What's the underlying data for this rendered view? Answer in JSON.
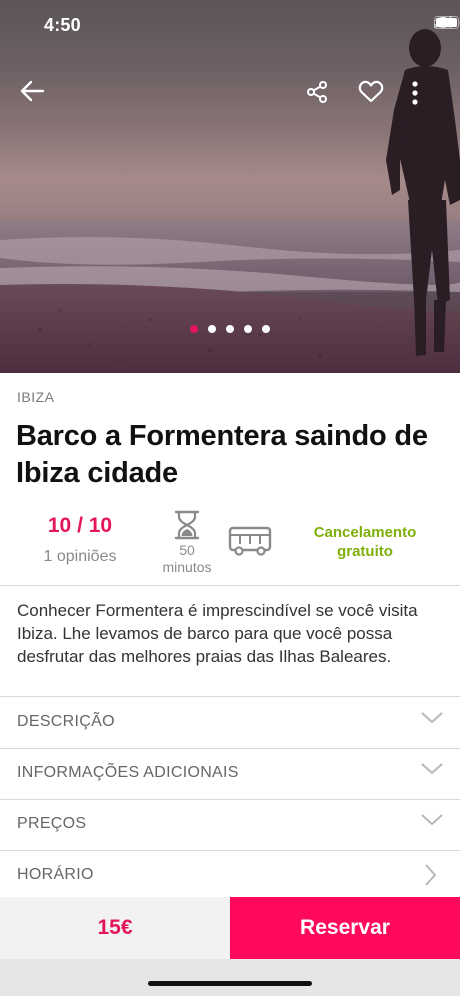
{
  "status_bar": {
    "time": "4:50"
  },
  "hero": {
    "carousel_total": 5,
    "carousel_active": 1
  },
  "activity": {
    "city": "IBIZA",
    "title": "Barco a Formentera saindo de Ibiza cidade",
    "rating_score": "10 / 10",
    "rating_count": "1 opiniões",
    "duration_value": "50",
    "duration_unit": "minutos",
    "cancellation": "Cancelamento gratuito",
    "description": "Conhecer Formentera é imprescindível se você visita Ibiza. Lhe levamos de barco para que você possa desfrutar das melhores praias das Ilhas Baleares."
  },
  "sections": [
    {
      "label": "DESCRIÇÃO",
      "icon": "chevron-down-icon"
    },
    {
      "label": "INFORMAÇÕES ADICIONAIS",
      "icon": "chevron-down-icon"
    },
    {
      "label": "PREÇOS",
      "icon": "chevron-down-icon"
    },
    {
      "label": "HORÁRIO",
      "icon": "chevron-right-icon"
    }
  ],
  "booking": {
    "price": "15€",
    "reserve_label": "Reservar"
  },
  "colors": {
    "accent": "#e4165b",
    "reserve_bg": "#ff0a5a",
    "cancellation": "#7db009"
  }
}
